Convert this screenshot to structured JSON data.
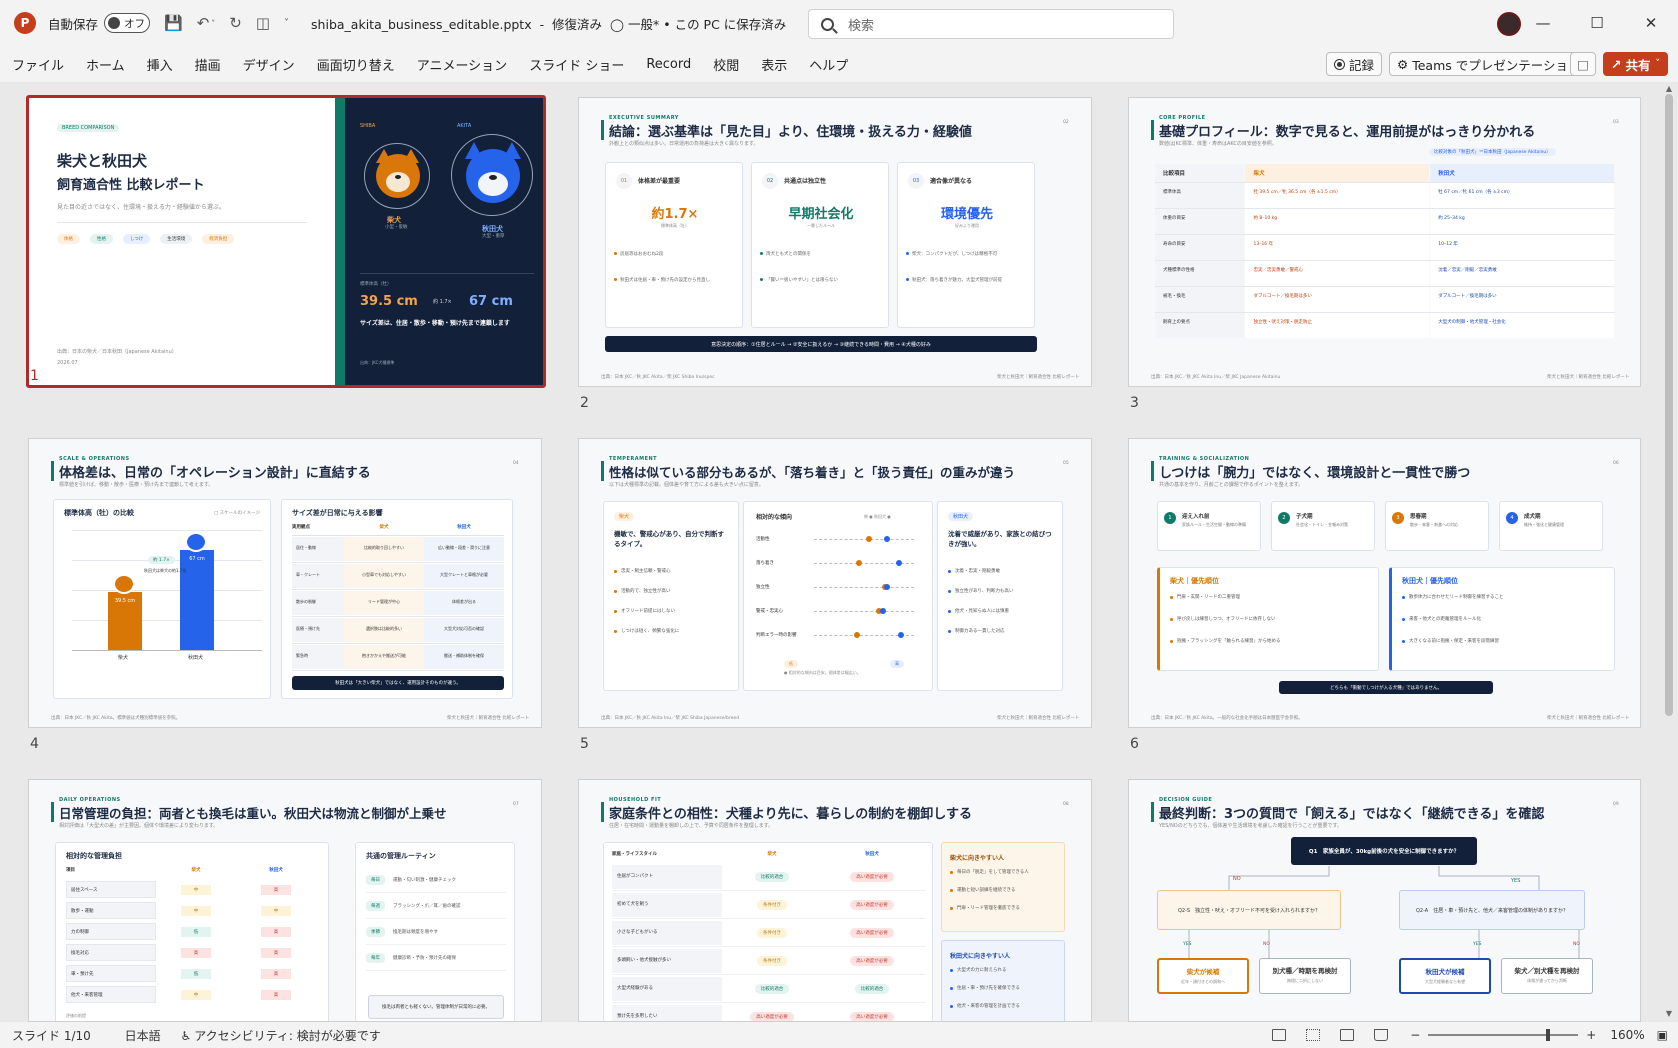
{
  "titlebar": {
    "app_logo": "P",
    "autosave_label": "自動保存",
    "autosave_state": "オフ",
    "document_title": "shiba_akita_business_editable.pptx",
    "repair_status": "修復済み",
    "sensitivity": "一般*",
    "save_status": "• この PC に保存済み",
    "search_placeholder": "検索"
  },
  "menu": [
    "ファイル",
    "ホーム",
    "挿入",
    "描画",
    "デザイン",
    "画面切り替え",
    "アニメーション",
    "スライド ショー",
    "Record",
    "校閲",
    "表示",
    "ヘルプ"
  ],
  "ribbon_right": {
    "record": "記録",
    "teams": "Teams でプレゼンテーション",
    "share": "共有"
  },
  "status": {
    "slide": "スライド 1/10",
    "language": "日本語",
    "accessibility": "アクセシビリティ: 検討が必要です",
    "zoom": "160%"
  },
  "colors": {
    "accent": "#c43e1c",
    "selected_border": "#b02a2a",
    "navy": "#12203a",
    "teal": "#0f7a68",
    "shiba": "#d97706",
    "akita": "#2563eb"
  },
  "slides": [
    {
      "num": "1",
      "tag": "BREED COMPARISON",
      "title1": "柴犬と秋田犬",
      "title2": "飼育適合性 比較レポート",
      "sub": "見た目の近さではなく、住環境・扱える力・経験値から選ぶ。",
      "chips": [
        "体格",
        "性格",
        "しつけ",
        "生活環境",
        "経済負担"
      ],
      "footer": "出典：日本の柴犬／日本秋田（Japanese Akitainu）",
      "date": "2026.07",
      "shiba_label": "SHIBA",
      "akita_label": "AKITA",
      "shiba_name": "柴犬",
      "akita_name": "秋田犬",
      "shiba_size": "小型・俊敏",
      "akita_size": "大型・重厚",
      "height_label": "標準体高（牡）",
      "shiba_height": "39.5 cm",
      "ratio": "約 1.7×",
      "akita_height": "67 cm",
      "summary": "サイズ差は、住居・散歩・移動・預け先まで連鎖します",
      "source": "出典：JKC犬種標準"
    },
    {
      "num": "2",
      "tag": "EXECUTIVE SUMMARY",
      "title": "結論：選ぶ基準は「見た目」より、住環境・扱える力・経験値",
      "sub": "外観上との類似点は多い。日常運用の負荷差は大きく異なります。",
      "pg": "02",
      "cards": [
        {
          "n": "01",
          "h": "体格差が最重要",
          "big": "約1.7×",
          "cap": "標準体高（牡）",
          "b1": "房居等はおおむね2段",
          "b2": "秋田犬は住居・車・預け先の設定から見直し"
        },
        {
          "n": "02",
          "h": "共通点は独立性",
          "big": "早期社会化",
          "cap": "一貫したルール",
          "b1": "両犬とも犬との関係を",
          "b2": "「賢い＝扱いやすい」とは限らない"
        },
        {
          "n": "03",
          "h": "適合像が異なる",
          "big": "環境優先",
          "cap": "好みより運用",
          "b1": "柴犬：コンパクトだが、しつけは精極不可",
          "b2": "秋田犬：落ち着きが魅力。大型犬管理が前提"
        }
      ],
      "banner": "意思決定の順序：①住居とルール → ②安全に扱えるか → ③継続できる時間・費用 → ④犬種の好み",
      "footer": "出典：日本 JKC／秋 JKC Akita／柴 JKC Shiba Inu/spec",
      "footer_r": "柴犬と秋田犬｜飼育適合性 比較レポート"
    },
    {
      "num": "3",
      "tag": "CORE PROFILE",
      "title": "基礎プロフィール：数字で見ると、運用前提がはっきり分かれる",
      "sub": "数値はJKC標準、体重・寿命はAKCの目安値を参照。",
      "pg": "03",
      "note": "比較対象の「秋田犬」＝日本秋田（Japanese Akitainu）",
      "head": [
        "比較項目",
        "柴犬",
        "秋田犬"
      ],
      "rows": [
        [
          "標準体高",
          "牡 39.5 cm／牝 36.5 cm（各 ±1.5 cm）",
          "牡 67 cm／牝 61 cm（各 ±3 cm）"
        ],
        [
          "体重の目安",
          "約 8–10 kg",
          "約 25–34 kg"
        ],
        [
          "寿命の目安",
          "13–16 年",
          "10–12 年"
        ],
        [
          "犬種標準の性格",
          "忠実／忠実勇敢／警戒心",
          "沈着／忠実／剛毅／忠実勇敢"
        ],
        [
          "被毛・換毛",
          "ダブルコート／換毛期は多い",
          "ダブルコート／換毛期は多い"
        ],
        [
          "飼育上の要点",
          "独立性・吠え対策・脱走防止",
          "大型犬の制御・他犬管理・社会化"
        ]
      ],
      "footer": "出典：日本 JKC／秋 JKC Akita Inu／柴 JKC Japanese Akitainu",
      "footer_r": "柴犬と秋田犬｜飼育適合性 比較レポート"
    },
    {
      "num": "4",
      "tag": "SCALE & OPERATIONS",
      "title": "体格差は、日常の「オペレーション設計」に直結する",
      "sub": "標準値を引けば、移動・散歩・医療・預け先まで連鎖して考えます。",
      "pg": "04",
      "chart_title": "標準体高（牡）の比較",
      "chart_note": "□ スケールのイメージ",
      "ratio": "約 1.7×",
      "ratio_note": "秋田犬は柴犬の約1.7倍",
      "table_title": "サイズ差が日常に与える影響",
      "table_head": [
        "実用観点",
        "柴犬",
        "秋田犬"
      ],
      "table_rows": [
        [
          "居住・動線",
          "比較的取り回しやすい",
          "広い動線・段差・滑りに注意"
        ],
        [
          "車・クレート",
          "小型車でも対応しやすい",
          "大型クレートと車格が必要"
        ],
        [
          "散歩の制御",
          "リード管理が中心",
          "体格差が出る"
        ],
        [
          "医療・預け先",
          "選択肢は比較的多い",
          "大型犬対応可否の確認"
        ],
        [
          "緊急時",
          "抱きかかえや搬送が可能",
          "搬送・補助体制を確保"
        ]
      ],
      "banner": "秋田犬は「大きい柴犬」ではなく、運用設計そのものが違う。",
      "footer": "出典：日本 JKC／秋 JKC Akita。標準値は犬種別標準値を参照。",
      "footer_r": "柴犬と秋田犬｜飼育適合性 比較レポート"
    },
    {
      "num": "5",
      "tag": "TEMPERAMENT",
      "title": "性格は似ている部分もあるが、「落ち着き」と「扱う責任」の重みが違う",
      "sub": "以下は犬種標準の記載。個体差や育て方による差も大きい点に留意。",
      "pg": "05",
      "left_tag": "柴犬",
      "left_h": "機敏で、警戒心があり、自分で判断するタイプ。",
      "left_items": [
        "忠実・飼主信頼・警戒心",
        "活動的で、独立性が高い",
        "オフリード前提にはしない",
        "しつけは短く、頻繁な強化に"
      ],
      "mid_title": "相対的な傾向",
      "mid_legend": "柴 ● 秋田犬 ●",
      "traits": [
        "活動性",
        "落ち着き",
        "独立性",
        "警戒・忠実心",
        "判断エラー時の影響"
      ],
      "mid_note": "● 相対的な傾向は目安。個体差は幅広い。",
      "mid_left": "低",
      "mid_right": "高",
      "right_tag": "秋田犬",
      "right_h": "沈着で威厳があり、家族との結びつきが強い。",
      "right_items": [
        "沈着・忠実・剛毅勇敢",
        "独立性があり、判断力も高い",
        "他犬・見知らぬ人には慎重",
        "制御力ある一貫した対応"
      ],
      "footer": "出典：日本 JKC／秋 JKC Akita Inu／柴 JKC Shiba Japanese/breed",
      "footer_r": "柴犬と秋田犬｜飼育適合性 比較レポート"
    },
    {
      "num": "6",
      "tag": "TRAINING & SOCIALIZATION",
      "title": "しつけは「腕力」ではなく、環境設計と一貫性で勝つ",
      "sub": "共通の基本を作り、月齢ごとの課題で作るポイントを整えます。",
      "pg": "06",
      "steps": [
        {
          "n": "1",
          "h": "迎え入れ前",
          "d": "家族ルール・生活空間・動線の準備"
        },
        {
          "n": "2",
          "h": "子犬期",
          "d": "社会化・トイレ・甘噛み対策"
        },
        {
          "n": "3",
          "h": "思春期",
          "d": "散歩・来客・刺激への対応"
        },
        {
          "n": "4",
          "h": "成犬期",
          "d": "維持・強化と健康管理"
        }
      ],
      "shiba_h": "柴犬｜優先順位",
      "shiba_items": [
        "門扉・玄関・リードの二重管理",
        "呼び戻しは練習しつつ、オフリードに依存しない",
        "抱擁・ブラッシングを「触られる練習」から始める"
      ],
      "akita_h": "秋田犬｜優先順位",
      "akita_items": [
        "散歩体力に合わせたリード制御を練習すること",
        "来客・他犬との距離管理をルール化",
        "大きくなる前に抱擁・保定・来客を段階練習"
      ],
      "banner": "どちらも「衝動でしつけが入る犬種」ではありません。",
      "footer": "出典：日本 JKC／秋 JKC Akita。一般的な社会化手順は日本獣医学会参照。",
      "footer_r": "柴犬と秋田犬｜飼育適合性 比較レポート"
    },
    {
      "num": "7",
      "tag": "DAILY OPERATIONS",
      "title": "日常管理の負担：両者とも換毛は重い。秋田犬は物流と制御が上乗せ",
      "sub": "相対評価は「大型犬の差」が主要因。個体や環境差により変わります。",
      "pg": "07",
      "left_title": "相対的な管理負担",
      "left_head": [
        "項目",
        "柴犬",
        "秋田犬"
      ],
      "left_rows": [
        [
          "居住スペース",
          "中",
          "高"
        ],
        [
          "散歩・運動",
          "中",
          "中"
        ],
        [
          "力の制御",
          "低",
          "高"
        ],
        [
          "換毛対応",
          "高",
          "高"
        ],
        [
          "車・預け先",
          "低",
          "高"
        ],
        [
          "他犬・来客管理",
          "中",
          "高"
        ]
      ],
      "left_note": "評価の前提",
      "right_title": "共通の管理ルーティン",
      "right_rows": [
        {
          "tag": "毎日",
          "t": "運動・匂い刺激・健康チェック"
        },
        {
          "tag": "毎週",
          "t": "ブラッシング・爪／耳／歯の確認"
        },
        {
          "tag": "季節",
          "t": "換毛期は頻度を増やす"
        },
        {
          "tag": "毎年",
          "t": "健康診断・予防・預け先の確保"
        }
      ],
      "right_note": "換毛は両者とも軽くない。管理体制が日常的に必要。",
      "footer": "",
      "footer_r": ""
    },
    {
      "num": "8",
      "tag": "HOUSEHOLD FIT",
      "title": "家庭条件との相性：犬種より先に、暮らしの制約を棚卸しする",
      "sub": "住居・在宅時間・運動量を棚卸しの上で、予算や同居条件を整理します。",
      "pg": "08",
      "head": [
        "家庭・ライフスタイル",
        "柴犬",
        "秋田犬"
      ],
      "rows": [
        "住居がコンパクト",
        "初めて犬を飼う",
        "小さな子どもがいる",
        "多頭飼い・他犬接触が多い",
        "大型犬経験がある",
        "預け先を多用したい"
      ],
      "shiba_cells": [
        "比較的適合",
        "条件付き",
        "条件付き",
        "条件付き",
        "比較的適合",
        "高い適度が必要"
      ],
      "akita_cells": [
        "高い適度が必要",
        "高い適度が必要",
        "高い適度が必要",
        "高い適度が必要",
        "比較的適合",
        "高い適度が必要"
      ],
      "card1_h": "柴犬に向きやすい人",
      "card1_items": [
        "毎日の「脱走」をして管理できる人",
        "運動と短い訓練を継続できる",
        "門扉・リード管理を徹底できる"
      ],
      "card2_h": "秋田犬に向きやすい人",
      "card2_items": [
        "大型犬の力に耐えられる",
        "住居・車・預け先を確保できる",
        "他犬・来客の管理を計画できる"
      ],
      "footer": "",
      "footer_r": ""
    },
    {
      "num": "9",
      "tag": "DECISION GUIDE",
      "title": "最終判断：3つの質問で「飼える」ではなく「継続できる」を確認",
      "sub": "YES/NOのどちらでも、個体差や生活環境を考慮した確認を行うことが重要です。",
      "pg": "09",
      "q1": "Q1　家族全員が、30kg前後の犬を安全に制御できますか？",
      "no": "NO",
      "yes": "YES",
      "q2s": "Q2-S　独立性・吠え・オフリード不可を受け入れられますか？",
      "q2a": "Q2-A　住居・車・預け先と、他犬／来客管理の体制がありますか？",
      "r1": "柴犬が候補",
      "r1s": "近年・顔付きとの調和へ",
      "r2": "別犬種／時期を再検討",
      "r2s": "無理に二択にしない",
      "r3": "秋田犬が候補",
      "r3s": "大型犬経験者なら有望",
      "r4": "柴犬／別犬種を再検討",
      "r4s": "体格が違ってから判断",
      "footer": "",
      "footer_r": ""
    }
  ]
}
